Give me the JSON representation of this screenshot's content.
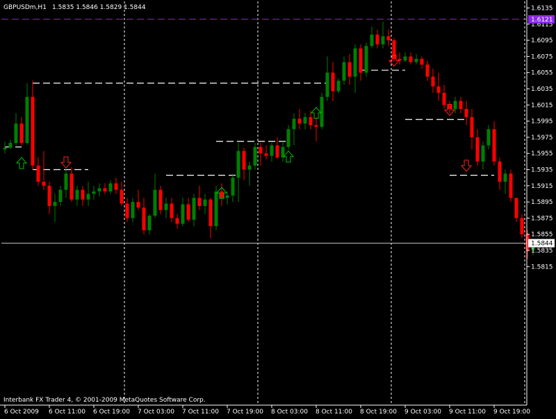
{
  "window": {
    "symbol_label": "GBPUSDm,H1",
    "ohlc_label": "1.5835 1.5846 1.5829 1.5844",
    "copyright": "Interbank FX Trader 4, © 2001-2009 MetaQuotes Software Corp."
  },
  "colors": {
    "background": "#000000",
    "bull": "#008000",
    "bear": "#ff0000",
    "wick_bull": "#008000",
    "wick_bear": "#ff0000",
    "axis_text": "#ffffff",
    "bid_line": "#c0c0c0",
    "alert_line": "#8a2be2",
    "separator": "#ffffff",
    "level_line": "#ffffff",
    "arrow_up": "#00c000",
    "arrow_down": "#ff2020"
  },
  "chart_data": {
    "type": "candlestick",
    "symbol": "GBPUSDm",
    "timeframe": "H1",
    "ylim": [
      1.581,
      1.614
    ],
    "y_ticks": [
      "1.6135",
      "1.6115",
      "1.6095",
      "1.6075",
      "1.6055",
      "1.6035",
      "1.6015",
      "1.5995",
      "1.5975",
      "1.5955",
      "1.5935",
      "1.5915",
      "1.5895",
      "1.5875",
      "1.5855",
      "1.5835",
      "1.5815"
    ],
    "x_labels": [
      {
        "bar": 0,
        "text": "6 Oct 2009"
      },
      {
        "bar": 8,
        "text": "6 Oct 11:00"
      },
      {
        "bar": 16,
        "text": "6 Oct 19:00"
      },
      {
        "bar": 24,
        "text": "7 Oct 03:00"
      },
      {
        "bar": 32,
        "text": "7 Oct 11:00"
      },
      {
        "bar": 40,
        "text": "7 Oct 19:00"
      },
      {
        "bar": 48,
        "text": "8 Oct 03:00"
      },
      {
        "bar": 56,
        "text": "8 Oct 11:00"
      },
      {
        "bar": 64,
        "text": "8 Oct 19:00"
      },
      {
        "bar": 72,
        "text": "9 Oct 03:00"
      },
      {
        "bar": 80,
        "text": "9 Oct 11:00"
      },
      {
        "bar": 88,
        "text": "9 Oct 19:00"
      }
    ],
    "day_separators": [
      21.5,
      45.5,
      69.5,
      93.5
    ],
    "bid_price": "1.5844",
    "alert_price": "1.6121",
    "ohlc": [
      {
        "o": 1.596,
        "h": 1.597,
        "l": 1.5955,
        "c": 1.5962
      },
      {
        "o": 1.5962,
        "h": 1.5972,
        "l": 1.596,
        "c": 1.5968
      },
      {
        "o": 1.5968,
        "h": 1.6005,
        "l": 1.5965,
        "c": 1.5992
      },
      {
        "o": 1.5992,
        "h": 1.6,
        "l": 1.5965,
        "c": 1.5968
      },
      {
        "o": 1.5968,
        "h": 1.6042,
        "l": 1.5966,
        "c": 1.6025
      },
      {
        "o": 1.6025,
        "h": 1.6045,
        "l": 1.5935,
        "c": 1.594
      },
      {
        "o": 1.594,
        "h": 1.595,
        "l": 1.5915,
        "c": 1.592
      },
      {
        "o": 1.592,
        "h": 1.5958,
        "l": 1.591,
        "c": 1.5915
      },
      {
        "o": 1.5915,
        "h": 1.592,
        "l": 1.588,
        "c": 1.589
      },
      {
        "o": 1.589,
        "h": 1.5905,
        "l": 1.587,
        "c": 1.5895
      },
      {
        "o": 1.5895,
        "h": 1.5915,
        "l": 1.589,
        "c": 1.591
      },
      {
        "o": 1.591,
        "h": 1.5935,
        "l": 1.59,
        "c": 1.593
      },
      {
        "o": 1.593,
        "h": 1.5938,
        "l": 1.5895,
        "c": 1.5898
      },
      {
        "o": 1.5898,
        "h": 1.5915,
        "l": 1.589,
        "c": 1.591
      },
      {
        "o": 1.591,
        "h": 1.5915,
        "l": 1.589,
        "c": 1.5898
      },
      {
        "o": 1.5898,
        "h": 1.592,
        "l": 1.589,
        "c": 1.5905
      },
      {
        "o": 1.5905,
        "h": 1.5915,
        "l": 1.5898,
        "c": 1.5908
      },
      {
        "o": 1.5908,
        "h": 1.5918,
        "l": 1.5902,
        "c": 1.5912
      },
      {
        "o": 1.5912,
        "h": 1.5918,
        "l": 1.5905,
        "c": 1.5908
      },
      {
        "o": 1.5908,
        "h": 1.5922,
        "l": 1.5905,
        "c": 1.5918
      },
      {
        "o": 1.5918,
        "h": 1.5925,
        "l": 1.5905,
        "c": 1.591
      },
      {
        "o": 1.591,
        "h": 1.592,
        "l": 1.589,
        "c": 1.5893
      },
      {
        "o": 1.5893,
        "h": 1.59,
        "l": 1.587,
        "c": 1.5875
      },
      {
        "o": 1.5875,
        "h": 1.59,
        "l": 1.587,
        "c": 1.5895
      },
      {
        "o": 1.5895,
        "h": 1.591,
        "l": 1.5885,
        "c": 1.5888
      },
      {
        "o": 1.5888,
        "h": 1.59,
        "l": 1.5855,
        "c": 1.586
      },
      {
        "o": 1.586,
        "h": 1.588,
        "l": 1.5855,
        "c": 1.5878
      },
      {
        "o": 1.5878,
        "h": 1.593,
        "l": 1.5875,
        "c": 1.591
      },
      {
        "o": 1.591,
        "h": 1.5915,
        "l": 1.588,
        "c": 1.5885
      },
      {
        "o": 1.5885,
        "h": 1.59,
        "l": 1.5875,
        "c": 1.5893
      },
      {
        "o": 1.5893,
        "h": 1.59,
        "l": 1.587,
        "c": 1.5875
      },
      {
        "o": 1.5875,
        "h": 1.588,
        "l": 1.5862,
        "c": 1.5868
      },
      {
        "o": 1.5868,
        "h": 1.59,
        "l": 1.5865,
        "c": 1.5892
      },
      {
        "o": 1.5892,
        "h": 1.59,
        "l": 1.587,
        "c": 1.5873
      },
      {
        "o": 1.5873,
        "h": 1.5905,
        "l": 1.5865,
        "c": 1.59
      },
      {
        "o": 1.59,
        "h": 1.5915,
        "l": 1.5885,
        "c": 1.589
      },
      {
        "o": 1.589,
        "h": 1.5905,
        "l": 1.588,
        "c": 1.5898
      },
      {
        "o": 1.5898,
        "h": 1.59,
        "l": 1.585,
        "c": 1.5865
      },
      {
        "o": 1.5865,
        "h": 1.5915,
        "l": 1.586,
        "c": 1.5908
      },
      {
        "o": 1.5908,
        "h": 1.5918,
        "l": 1.589,
        "c": 1.59
      },
      {
        "o": 1.59,
        "h": 1.5908,
        "l": 1.5892,
        "c": 1.5903
      },
      {
        "o": 1.5903,
        "h": 1.593,
        "l": 1.5895,
        "c": 1.5925
      },
      {
        "o": 1.5925,
        "h": 1.5968,
        "l": 1.5895,
        "c": 1.5958
      },
      {
        "o": 1.5958,
        "h": 1.5962,
        "l": 1.5922,
        "c": 1.5935
      },
      {
        "o": 1.5935,
        "h": 1.5945,
        "l": 1.5915,
        "c": 1.594
      },
      {
        "o": 1.594,
        "h": 1.5968,
        "l": 1.5935,
        "c": 1.5963
      },
      {
        "o": 1.5963,
        "h": 1.5968,
        "l": 1.594,
        "c": 1.5955
      },
      {
        "o": 1.5955,
        "h": 1.5965,
        "l": 1.5948,
        "c": 1.5952
      },
      {
        "o": 1.5952,
        "h": 1.5968,
        "l": 1.5945,
        "c": 1.5965
      },
      {
        "o": 1.5965,
        "h": 1.5975,
        "l": 1.5948,
        "c": 1.595
      },
      {
        "o": 1.595,
        "h": 1.597,
        "l": 1.5945,
        "c": 1.5963
      },
      {
        "o": 1.5963,
        "h": 1.599,
        "l": 1.596,
        "c": 1.5985
      },
      {
        "o": 1.5985,
        "h": 1.6005,
        "l": 1.5965,
        "c": 1.5998
      },
      {
        "o": 1.5998,
        "h": 1.601,
        "l": 1.5985,
        "c": 1.5992
      },
      {
        "o": 1.5992,
        "h": 1.6005,
        "l": 1.5985,
        "c": 1.6
      },
      {
        "o": 1.6,
        "h": 1.6008,
        "l": 1.5985,
        "c": 1.599
      },
      {
        "o": 1.599,
        "h": 1.6,
        "l": 1.597,
        "c": 1.5988
      },
      {
        "o": 1.5988,
        "h": 1.603,
        "l": 1.5985,
        "c": 1.6025
      },
      {
        "o": 1.6025,
        "h": 1.6075,
        "l": 1.602,
        "c": 1.6055
      },
      {
        "o": 1.6055,
        "h": 1.6068,
        "l": 1.602,
        "c": 1.6032
      },
      {
        "o": 1.6032,
        "h": 1.6048,
        "l": 1.603,
        "c": 1.6045
      },
      {
        "o": 1.6045,
        "h": 1.6075,
        "l": 1.604,
        "c": 1.6068
      },
      {
        "o": 1.6068,
        "h": 1.6078,
        "l": 1.604,
        "c": 1.605
      },
      {
        "o": 1.605,
        "h": 1.609,
        "l": 1.603,
        "c": 1.6085
      },
      {
        "o": 1.6085,
        "h": 1.609,
        "l": 1.6045,
        "c": 1.6055
      },
      {
        "o": 1.6055,
        "h": 1.6092,
        "l": 1.605,
        "c": 1.6088
      },
      {
        "o": 1.6088,
        "h": 1.6112,
        "l": 1.6085,
        "c": 1.6102
      },
      {
        "o": 1.6102,
        "h": 1.6108,
        "l": 1.6085,
        "c": 1.609
      },
      {
        "o": 1.609,
        "h": 1.6118,
        "l": 1.6085,
        "c": 1.61
      },
      {
        "o": 1.61,
        "h": 1.6108,
        "l": 1.6088,
        "c": 1.6095
      },
      {
        "o": 1.6095,
        "h": 1.6098,
        "l": 1.6068,
        "c": 1.6072
      },
      {
        "o": 1.6072,
        "h": 1.608,
        "l": 1.6065,
        "c": 1.607
      },
      {
        "o": 1.607,
        "h": 1.608,
        "l": 1.6068,
        "c": 1.6075
      },
      {
        "o": 1.6075,
        "h": 1.608,
        "l": 1.6065,
        "c": 1.6068
      },
      {
        "o": 1.6068,
        "h": 1.6078,
        "l": 1.6065,
        "c": 1.6072
      },
      {
        "o": 1.6072,
        "h": 1.6075,
        "l": 1.606,
        "c": 1.6065
      },
      {
        "o": 1.6065,
        "h": 1.607,
        "l": 1.6045,
        "c": 1.605
      },
      {
        "o": 1.605,
        "h": 1.606,
        "l": 1.603,
        "c": 1.6038
      },
      {
        "o": 1.6038,
        "h": 1.6055,
        "l": 1.602,
        "c": 1.603
      },
      {
        "o": 1.603,
        "h": 1.604,
        "l": 1.601,
        "c": 1.6015
      },
      {
        "o": 1.6015,
        "h": 1.602,
        "l": 1.6005,
        "c": 1.601
      },
      {
        "o": 1.601,
        "h": 1.6025,
        "l": 1.6005,
        "c": 1.602
      },
      {
        "o": 1.602,
        "h": 1.6025,
        "l": 1.6005,
        "c": 1.601
      },
      {
        "o": 1.601,
        "h": 1.602,
        "l": 1.599,
        "c": 1.6
      },
      {
        "o": 1.6,
        "h": 1.601,
        "l": 1.596,
        "c": 1.5975
      },
      {
        "o": 1.5975,
        "h": 1.5985,
        "l": 1.594,
        "c": 1.5945
      },
      {
        "o": 1.5945,
        "h": 1.597,
        "l": 1.5935,
        "c": 1.5965
      },
      {
        "o": 1.5965,
        "h": 1.599,
        "l": 1.596,
        "c": 1.5985
      },
      {
        "o": 1.5985,
        "h": 1.5995,
        "l": 1.594,
        "c": 1.5945
      },
      {
        "o": 1.5945,
        "h": 1.595,
        "l": 1.591,
        "c": 1.592
      },
      {
        "o": 1.592,
        "h": 1.5935,
        "l": 1.5905,
        "c": 1.593
      },
      {
        "o": 1.593,
        "h": 1.5935,
        "l": 1.5895,
        "c": 1.59
      },
      {
        "o": 1.59,
        "h": 1.59,
        "l": 1.587,
        "c": 1.5875
      },
      {
        "o": 1.5875,
        "h": 1.588,
        "l": 1.585,
        "c": 1.5855
      },
      {
        "o": 1.5855,
        "h": 1.586,
        "l": 1.5825,
        "c": 1.5835
      },
      {
        "o": 1.5835,
        "h": 1.5846,
        "l": 1.5829,
        "c": 1.5844
      }
    ],
    "levels": [
      {
        "from": 0,
        "to": 3,
        "price": 1.5963
      },
      {
        "from": 5,
        "to": 58,
        "price": 1.6042
      },
      {
        "from": 5,
        "to": 15,
        "price": 1.5935
      },
      {
        "from": 29,
        "to": 42,
        "price": 1.5928
      },
      {
        "from": 38,
        "to": 51,
        "price": 1.597
      },
      {
        "from": 64,
        "to": 72,
        "price": 1.6058
      },
      {
        "from": 72,
        "to": 83,
        "price": 1.5997
      },
      {
        "from": 80,
        "to": 88,
        "price": 1.5928
      }
    ],
    "arrows": [
      {
        "bar": 3,
        "price": 1.595,
        "dir": "up"
      },
      {
        "bar": 11,
        "price": 1.5937,
        "dir": "down"
      },
      {
        "bar": 39,
        "price": 1.5913,
        "dir": "up"
      },
      {
        "bar": 51,
        "price": 1.5958,
        "dir": "up"
      },
      {
        "bar": 56,
        "price": 1.6012,
        "dir": "up"
      },
      {
        "bar": 70,
        "price": 1.6063,
        "dir": "down"
      },
      {
        "bar": 80,
        "price": 1.6002,
        "dir": "down"
      },
      {
        "bar": 83,
        "price": 1.5933,
        "dir": "down"
      }
    ]
  }
}
